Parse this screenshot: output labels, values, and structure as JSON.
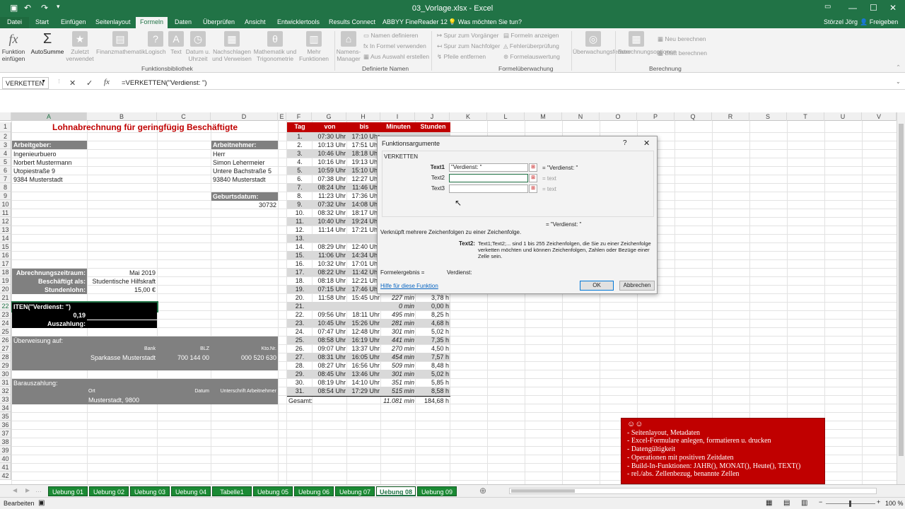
{
  "window": {
    "title": "03_Vorlage.xlsx - Excel",
    "user": "Störzel Jörg",
    "share": "Freigeben"
  },
  "tabs": [
    "Datei",
    "Start",
    "Einfügen",
    "Seitenlayout",
    "Formeln",
    "Daten",
    "Überprüfen",
    "Ansicht",
    "Entwicklertools",
    "Results Connect",
    "ABBYY FineReader 12",
    "Was möchten Sie tun?"
  ],
  "ribbon": {
    "fx": "Funktion einfügen",
    "autosum": "AutoSumme",
    "recent": "Zuletzt verwendet",
    "fin": "Finanzmathematik",
    "logic": "Logisch",
    "text": "Text",
    "date": "Datum u. Uhrzeit",
    "lookup": "Nachschlagen und Verweisen",
    "math": "Mathematik und Trigonometrie",
    "more": "Mehr Funktionen",
    "group1": "Funktionsbibliothek",
    "names": "Namens-Manager",
    "define": "Namen definieren",
    "inFormula": "In Formel verwenden",
    "fromSel": "Aus Auswahl erstellen",
    "group2": "Definierte Namen",
    "trace1": "Spur zum Vorgänger",
    "trace2": "Spur zum Nachfolger",
    "remove": "Pfeile entfernen",
    "show": "Formeln anzeigen",
    "errcheck": "Fehlerüberprüfung",
    "evalf": "Formelauswertung",
    "group3": "Formelüberwachung",
    "watch": "Überwachungsfenster",
    "calcopt": "Berechnungsoptionen",
    "calcnow": "Neu berechnen",
    "calcsheet": "Blatt berechnen",
    "group4": "Berechnung"
  },
  "formulaBar": {
    "name": "VERKETTEN",
    "formula": "=VERKETTEN(\"Verdienst: \")"
  },
  "columns": [
    "A",
    "B",
    "C",
    "D",
    "E",
    "F",
    "G",
    "H",
    "I",
    "J",
    "K",
    "L",
    "M",
    "N",
    "O",
    "P",
    "Q",
    "R",
    "S",
    "T",
    "U",
    "V"
  ],
  "sheet": {
    "title": "Lohnabrechnung für geringfügig Beschäftigte",
    "employerLabel": "Arbeitgeber:",
    "employer": [
      "Ingenieurbuero",
      "Norbert Mustermann",
      "Utopiestraße 9",
      "9384 Musterstadt"
    ],
    "employeeLabel": "Arbeitnehmer:",
    "employee": [
      "Herr",
      "Simon Lehermeier",
      "Untere Bachstraße 5",
      "93840 Musterstadt"
    ],
    "birthLabel": "Geburtsdatum:",
    "birth": "30732",
    "periodLabel": "Abrechnungszeitraum:",
    "period": "Mai 2019",
    "employedLabel": "Beschäftigt als:",
    "employed": "Studentische Hilfskraft",
    "wageLabel": "Stundenlohn:",
    "wage": "15,00 €",
    "earnFormula": "ITEN(\"Verdienst: \")",
    "earnValue": "0,19",
    "payoutLabel": "Auszahlung:",
    "transferLabel": "Überweisung auf:",
    "bank": "Bank",
    "blz": "BLZ",
    "kto": "Kto.Nr.",
    "bankName": "Sparkasse Musterstadt",
    "blzVal": "700 144 00",
    "ktoVal": "000 520 630",
    "cashLabel": "Barauszahlung:",
    "ort": "Ort",
    "datum": "Datum",
    "sign": "Unterschrift Arbeitnehmer",
    "ortVal": "Musterstadt, 9800",
    "tableHead": [
      "Tag",
      "von",
      "bis",
      "Minuten",
      "Stunden"
    ],
    "total": {
      "label": "Gesamt:",
      "min": "11.081 min",
      "h": "184,68 h"
    }
  },
  "days": [
    [
      "1.",
      "07:30 Uhr",
      "17:10 Uhr",
      "",
      ""
    ],
    [
      "2.",
      "10:13 Uhr",
      "17:51 Uhr",
      "",
      ""
    ],
    [
      "3.",
      "10:46 Uhr",
      "18:18 Uhr",
      "",
      ""
    ],
    [
      "4.",
      "10:16 Uhr",
      "19:13 Uhr",
      "",
      ""
    ],
    [
      "5.",
      "10:59 Uhr",
      "15:10 Uhr",
      "",
      ""
    ],
    [
      "6.",
      "07:38 Uhr",
      "12:27 Uhr",
      "",
      ""
    ],
    [
      "7.",
      "08:24 Uhr",
      "11:46 Uhr",
      "",
      ""
    ],
    [
      "8.",
      "11:23 Uhr",
      "17:36 Uhr",
      "",
      ""
    ],
    [
      "9.",
      "07:32 Uhr",
      "14:08 Uhr",
      "",
      ""
    ],
    [
      "10.",
      "08:32 Uhr",
      "18:17 Uhr",
      "",
      ""
    ],
    [
      "11.",
      "10:40 Uhr",
      "19:24 Uhr",
      "",
      ""
    ],
    [
      "12.",
      "11:14 Uhr",
      "17:21 Uhr",
      "",
      ""
    ],
    [
      "13.",
      "",
      "",
      "",
      ""
    ],
    [
      "14.",
      "08:29 Uhr",
      "12:40 Uhr",
      "",
      ""
    ],
    [
      "15.",
      "11:06 Uhr",
      "14:34 Uhr",
      "",
      ""
    ],
    [
      "16.",
      "10:32 Uhr",
      "17:01 Uhr",
      "",
      ""
    ],
    [
      "17.",
      "08:22 Uhr",
      "11:42 Uhr",
      "",
      ""
    ],
    [
      "18.",
      "08:18 Uhr",
      "12:21 Uhr",
      "",
      ""
    ],
    [
      "19.",
      "07:15 Uhr",
      "17:46 Uhr",
      "",
      ""
    ],
    [
      "20.",
      "11:58 Uhr",
      "15:45 Uhr",
      "227 min",
      "3,78 h"
    ],
    [
      "21.",
      "",
      "",
      "0 min",
      "0,00 h"
    ],
    [
      "22.",
      "09:56 Uhr",
      "18:11 Uhr",
      "495 min",
      "8,25 h"
    ],
    [
      "23.",
      "10:45 Uhr",
      "15:26 Uhr",
      "281 min",
      "4,68 h"
    ],
    [
      "24.",
      "07:47 Uhr",
      "12:48 Uhr",
      "301 min",
      "5,02 h"
    ],
    [
      "25.",
      "08:58 Uhr",
      "16:19 Uhr",
      "441 min",
      "7,35 h"
    ],
    [
      "26.",
      "09:07 Uhr",
      "13:37 Uhr",
      "270 min",
      "4,50 h"
    ],
    [
      "27.",
      "08:31 Uhr",
      "16:05 Uhr",
      "454 min",
      "7,57 h"
    ],
    [
      "28.",
      "08:27 Uhr",
      "16:56 Uhr",
      "509 min",
      "8,48 h"
    ],
    [
      "29.",
      "08:45 Uhr",
      "13:46 Uhr",
      "301 min",
      "5,02 h"
    ],
    [
      "30.",
      "08:19 Uhr",
      "14:10 Uhr",
      "351 min",
      "5,85 h"
    ],
    [
      "31.",
      "08:54 Uhr",
      "17:29 Uhr",
      "515 min",
      "8,58 h"
    ]
  ],
  "dialog": {
    "title": "Funktionsargumente",
    "help": "?",
    "close": "✕",
    "fn": "VERKETTEN",
    "l1": "Text1",
    "v1": "\"Verdienst: \"",
    "r1": "= \"Verdienst: \"",
    "l2": "Text2",
    "v2": "",
    "r2": "= text",
    "l3": "Text3",
    "v3": "",
    "r3": "= text",
    "result": "= \"Verdienst: \"",
    "desc": "Verknüpft mehrere Zeichenfolgen zu einer Zeichenfolge.",
    "argName": "Text2:",
    "argDesc": "Text1;Text2;... sind 1 bis 255 Zeichenfolgen, die Sie zu einer Zeichenfolge verketten möchten und können Zeichenfolgen, Zahlen oder Bezüge einer Zelle sein.",
    "resLabel": "Formelergebnis =",
    "resVal": "Verdienst:",
    "helpLink": "Hilfe für diese Funktion",
    "ok": "OK",
    "cancel": "Abbrechen"
  },
  "sheetTabs": [
    "Uebung 01",
    "Uebung 02",
    "Uebung 03",
    "Uebung 04",
    "Tabelle1",
    "Uebung 05",
    "Uebung 06",
    "Uebung 07",
    "Uebung 08",
    "Uebung 09"
  ],
  "activeTab": "Uebung 08",
  "status": {
    "mode": "Bearbeiten",
    "zoom": "100 %"
  },
  "note": {
    "head": "☺☺",
    "items": [
      "- Seitenlayout, Metadaten",
      "- Excel-Formulare anlegen, formatieren u. drucken",
      "- Datengültigkeit",
      "- Operationen mit positiven Zeitdaten",
      "- Build-In-Funktionen: JAHR(), MONAT(), Heute(), TEXT()",
      "- rel./abs. Zellenbezug, benannte Zellen"
    ]
  }
}
